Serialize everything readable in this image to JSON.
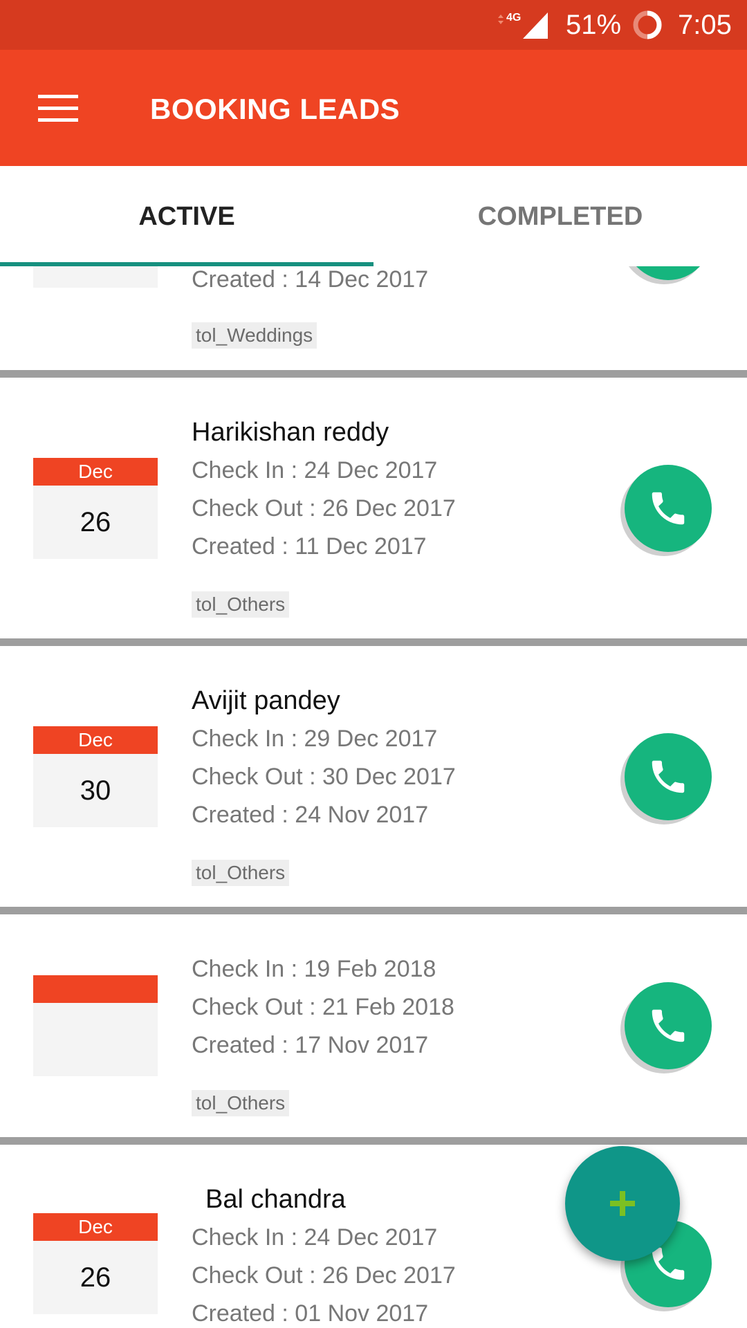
{
  "status_bar": {
    "network": "4G",
    "battery": "51%",
    "battery_level": 0.51,
    "time": "7:05"
  },
  "app_bar": {
    "title": "BOOKING LEADS",
    "menu_icon": "hamburger-icon"
  },
  "tabs": [
    {
      "label": "ACTIVE",
      "selected": true
    },
    {
      "label": "COMPLETED",
      "selected": false
    }
  ],
  "colors": {
    "status": "#d63a1f",
    "primary": "#ef4423",
    "accent": "#16907f",
    "call": "#16b57e",
    "fab": "#0f9688",
    "fab_plus": "#7cc022"
  },
  "leads": [
    {
      "created": "Created : 14 Dec 2017",
      "tag": "tol_Weddings"
    },
    {
      "name": "Harikishan reddy",
      "month": "Dec",
      "day": "26",
      "check_in": "Check In : 24 Dec 2017",
      "check_out": "Check Out : 26 Dec 2017",
      "created": "Created : 11 Dec 2017",
      "tag": "tol_Others"
    },
    {
      "name": "Avijit pandey",
      "month": "Dec",
      "day": "30",
      "check_in": "Check In : 29 Dec 2017",
      "check_out": "Check Out : 30 Dec 2017",
      "created": "Created : 24 Nov 2017",
      "tag": "tol_Others"
    },
    {
      "check_in": "Check In : 19 Feb 2018",
      "check_out": "Check Out : 21 Feb 2018",
      "created": "Created : 17 Nov 2017",
      "tag": "tol_Others"
    },
    {
      "name": "Bal chandra",
      "month": "Dec",
      "day": "26",
      "check_in": "Check In : 24 Dec 2017",
      "check_out": "Check Out : 26 Dec 2017",
      "created": "Created : 01 Nov 2017"
    }
  ],
  "fab": {
    "icon": "plus-icon"
  }
}
